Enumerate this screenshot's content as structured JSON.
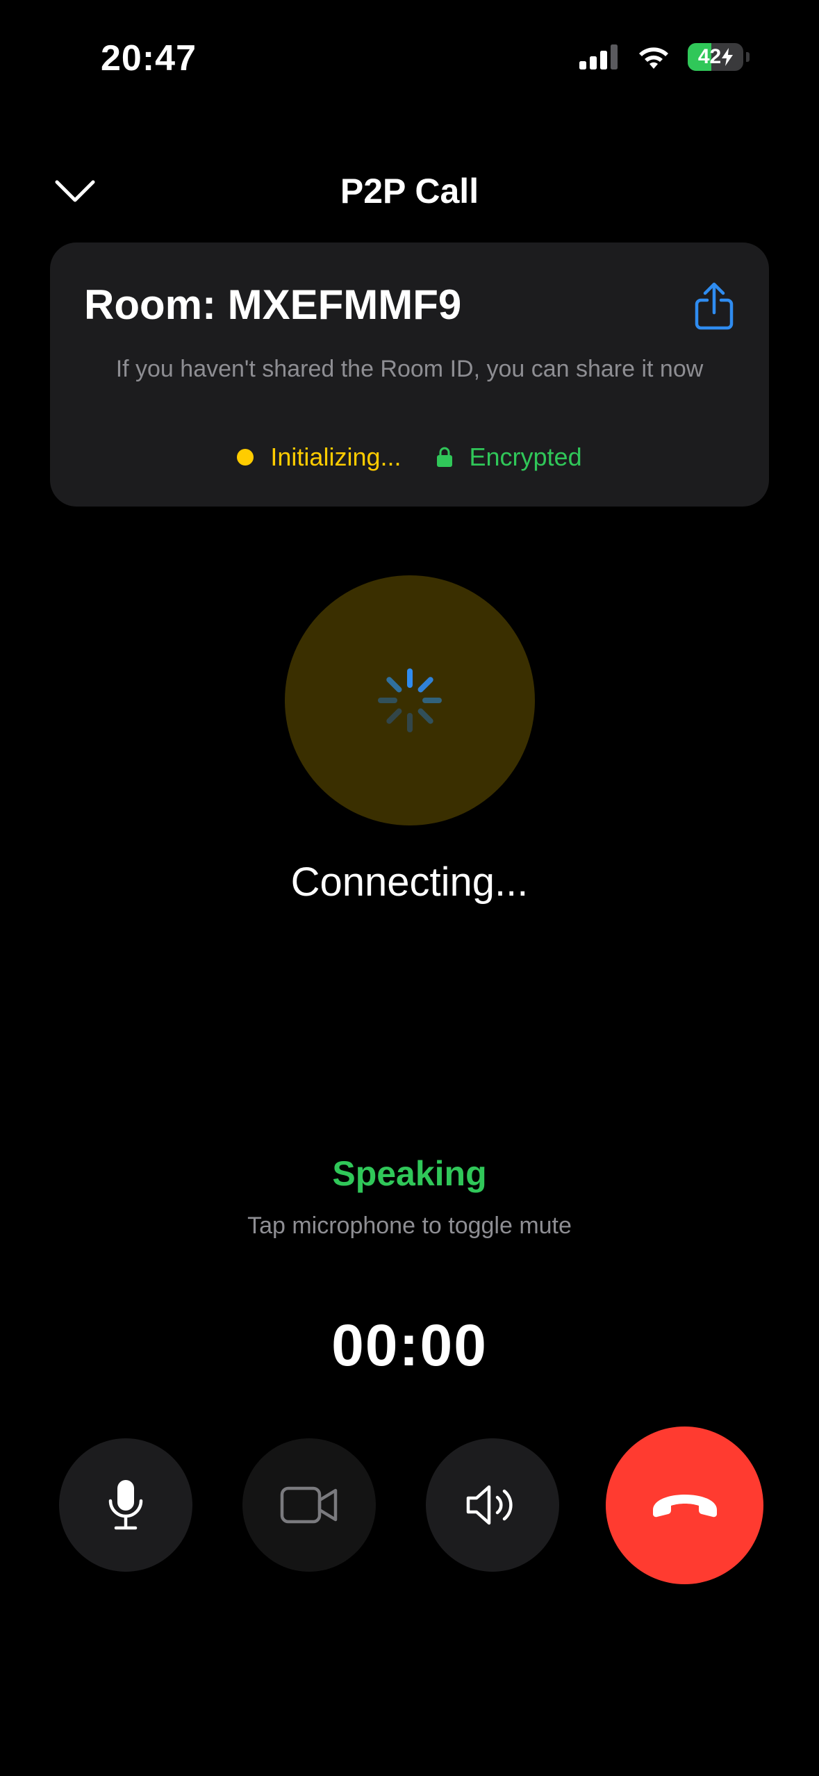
{
  "status_bar": {
    "time": "20:47",
    "battery_level": "42",
    "battery_fraction": 0.42,
    "icons": [
      "cellular-signal-icon",
      "wifi-icon",
      "battery-charging-icon"
    ]
  },
  "header": {
    "title": "P2P Call",
    "back_icon": "chevron-down-icon"
  },
  "room_card": {
    "title": "Room: MXEFMMF9",
    "share_icon": "share-icon",
    "hint": "If you haven't shared the Room ID, you can share it now",
    "status_label": "Initializing...",
    "encryption_label": "Encrypted"
  },
  "call": {
    "spinner_icon": "loading-spinner-icon",
    "connecting_label": "Connecting...",
    "speaking_label": "Speaking",
    "mute_hint": "Tap microphone to toggle mute",
    "timer": "00:00"
  },
  "controls": [
    {
      "name": "microphone-button",
      "icon": "microphone-icon"
    },
    {
      "name": "video-button",
      "icon": "video-camera-icon"
    },
    {
      "name": "speaker-button",
      "icon": "speaker-icon"
    },
    {
      "name": "end-call-button",
      "icon": "phone-hangup-icon"
    }
  ],
  "colors": {
    "background": "#000000",
    "card": "#1c1c1e",
    "accent_blue": "#2f8cf0",
    "status_yellow": "#ffcc00",
    "status_green": "#30c759",
    "end_call_red": "#ff3b30",
    "avatar_bg": "#3a2f00",
    "secondary_text": "#8e8e93"
  }
}
